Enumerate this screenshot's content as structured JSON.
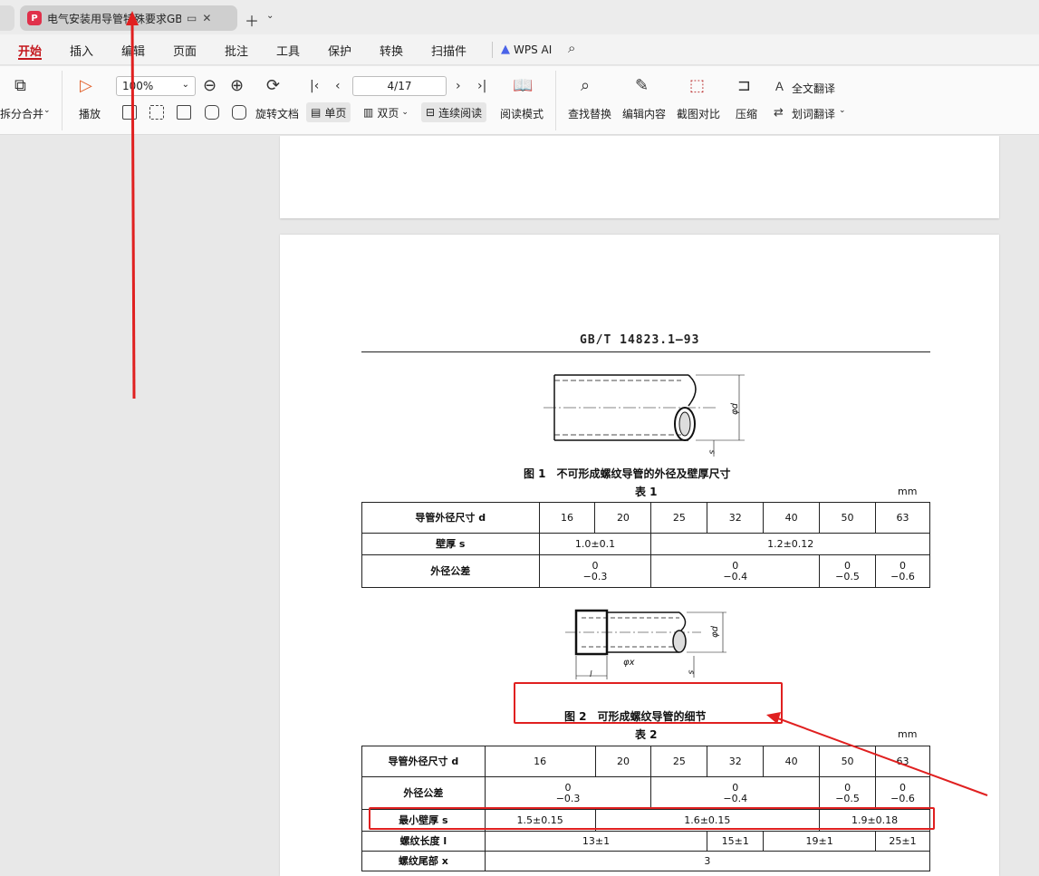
{
  "tab": {
    "title": "电气安装用导管特殊要求GB T"
  },
  "menu": [
    "开始",
    "插入",
    "编辑",
    "页面",
    "批注",
    "工具",
    "保护",
    "转换",
    "扫描件"
  ],
  "wps_ai": "WPS AI",
  "toolbar": {
    "split_merge": "拆分合并",
    "play": "播放",
    "zoom": "100%",
    "page_indicator": "4/17",
    "rotate": "旋转文档",
    "single_page": "单页",
    "double_page": "双页",
    "continuous": "连续阅读",
    "reading_mode": "阅读模式",
    "find_replace": "查找替换",
    "edit_content": "编辑内容",
    "screenshot_compare": "截图对比",
    "compress": "压缩",
    "full_translate": "全文翻译",
    "word_translate": "划词翻译"
  },
  "doc": {
    "std_header": "GB/T 14823.1—93",
    "fig1_caption": "图 1　不可形成螺纹导管的外径及壁厚尺寸",
    "table1_title": "表 1",
    "unit": "mm",
    "fig1_labels": {
      "phi_d": "φd",
      "s": "s"
    },
    "table1": {
      "r1_label": "导管外径尺寸 d",
      "sizes": [
        "16",
        "20",
        "25",
        "32",
        "40",
        "50",
        "63"
      ],
      "r2_label": "壁厚 s",
      "wall_a": "1.0±0.1",
      "wall_b": "1.2±0.12",
      "r3_label": "外径公差",
      "tol_a_top": "0",
      "tol_a_bot": "−0.3",
      "tol_b_top": "0",
      "tol_b_bot": "−0.4",
      "tol_c_top": "0",
      "tol_c_bot": "−0.5",
      "tol_d_top": "0",
      "tol_d_bot": "−0.6"
    },
    "fig2_caption": "图 2　可形成螺纹导管的细节",
    "fig2_labels": {
      "phi_d": "φd",
      "phi_x": "φx",
      "s": "s",
      "l": "l"
    },
    "table2_title": "表 2",
    "table2": {
      "r1_label": "导管外径尺寸 d",
      "sizes": [
        "16",
        "20",
        "25",
        "32",
        "40",
        "50",
        "63"
      ],
      "r2_label": "外径公差",
      "tol_a_top": "0",
      "tol_a_bot": "−0.3",
      "tol_b_top": "0",
      "tol_b_bot": "−0.4",
      "tol_c_top": "0",
      "tol_c_bot": "−0.5",
      "tol_d_top": "0",
      "tol_d_bot": "−0.6",
      "r3_label": "最小壁厚 s",
      "min_a": "1.5±0.15",
      "min_b": "1.6±0.15",
      "min_c": "1.9±0.18",
      "r4_label": "螺纹长度 l",
      "len_a": "13±1",
      "len_b": "15±1",
      "len_c": "19±1",
      "len_d": "25±1",
      "r5_label": "螺纹尾部 x",
      "tail": "3"
    }
  },
  "annotation_color": "#e02020"
}
